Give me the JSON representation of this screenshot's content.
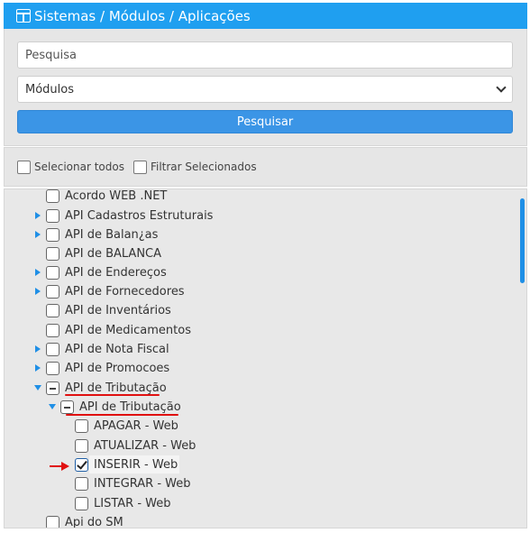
{
  "header": {
    "title": "Sistemas / Módulos / Aplicações"
  },
  "filters": {
    "search_placeholder": "Pesquisa",
    "select_value": "Módulos",
    "search_button": "Pesquisar"
  },
  "selection": {
    "select_all": "Selecionar todos",
    "filter_selected": "Filtrar Selecionados"
  },
  "tree": {
    "items": [
      {
        "label": "Acordo WEB .NET",
        "state": "unchecked",
        "expander": "none"
      },
      {
        "label": "API Cadastros Estruturais",
        "state": "unchecked",
        "expander": "collapsed"
      },
      {
        "label": "API de Balan¿as",
        "state": "unchecked",
        "expander": "collapsed"
      },
      {
        "label": "API de BALANCA",
        "state": "unchecked",
        "expander": "none"
      },
      {
        "label": "API de Endereços",
        "state": "unchecked",
        "expander": "collapsed"
      },
      {
        "label": "API de Fornecedores",
        "state": "unchecked",
        "expander": "collapsed"
      },
      {
        "label": "API de Inventários",
        "state": "unchecked",
        "expander": "none"
      },
      {
        "label": "API de Medicamentos",
        "state": "unchecked",
        "expander": "none"
      },
      {
        "label": "API de Nota Fiscal",
        "state": "unchecked",
        "expander": "collapsed"
      },
      {
        "label": "API de Promocoes",
        "state": "unchecked",
        "expander": "collapsed"
      },
      {
        "label": "API de Tributação",
        "state": "partial",
        "expander": "expanded"
      },
      {
        "label": "API de Tributação",
        "state": "partial",
        "expander": "expanded"
      },
      {
        "label": "APAGAR - Web",
        "state": "unchecked",
        "expander": "none"
      },
      {
        "label": "ATUALIZAR - Web",
        "state": "unchecked",
        "expander": "none"
      },
      {
        "label": "INSERIR - Web",
        "state": "checked",
        "expander": "none"
      },
      {
        "label": "INTEGRAR - Web",
        "state": "unchecked",
        "expander": "none"
      },
      {
        "label": "LISTAR - Web",
        "state": "unchecked",
        "expander": "none"
      },
      {
        "label": "Api do SM",
        "state": "unchecked",
        "expander": "none"
      }
    ]
  },
  "colors": {
    "accent": "#1f9ff0",
    "button": "#3b95e6",
    "annotation": "#e01010"
  }
}
